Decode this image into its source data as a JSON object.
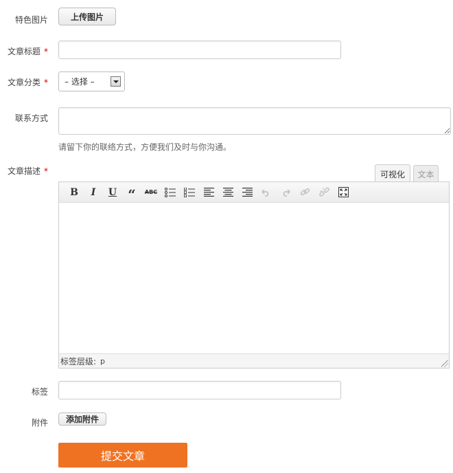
{
  "featured_image": {
    "label": "特色图片",
    "upload_button": "上传图片"
  },
  "title_field": {
    "label": "文章标题",
    "required_mark": "*",
    "value": ""
  },
  "category_field": {
    "label": "文章分类",
    "required_mark": "*",
    "selected": "– 选择 –"
  },
  "contact_field": {
    "label": "联系方式",
    "value": "",
    "hint": "请留下你的联络方式，方便我们及时与你沟通。"
  },
  "description_field": {
    "label": "文章描述",
    "required_mark": "*",
    "tabs": {
      "visual": "可视化",
      "text": "文本"
    },
    "toolbar": {
      "bold": "B",
      "italic": "I",
      "underline": "U",
      "quote": "“",
      "strike": "ABC"
    },
    "status_path_label": "标签层级:",
    "status_path_value": "p"
  },
  "tags_field": {
    "label": "标签",
    "value": ""
  },
  "attachment_field": {
    "label": "附件",
    "add_button": "添加附件"
  },
  "submit_button": "提交文章",
  "colors": {
    "submit_bg": "#ee7222",
    "required": "#cc0000"
  }
}
